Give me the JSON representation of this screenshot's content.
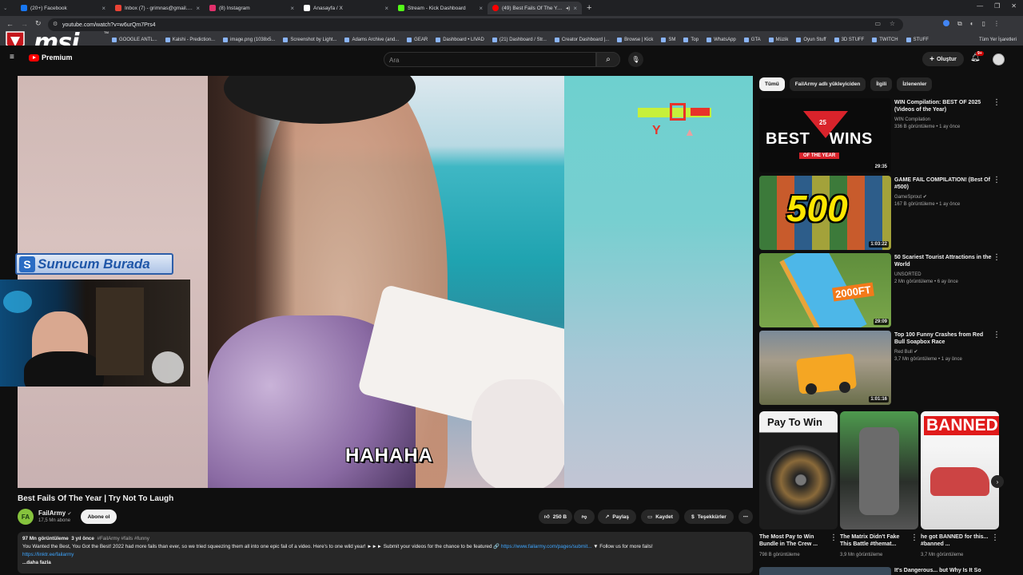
{
  "browser": {
    "tabs": [
      {
        "title": "(20+) Facebook",
        "color": "#1877f2"
      },
      {
        "title": "Inbox (7) - grimnas@gmail.com",
        "color": "#ea4335"
      },
      {
        "title": "(8) Instagram",
        "color": "#e1306c"
      },
      {
        "title": "Anasayfa / X",
        "color": "#ffffff"
      },
      {
        "title": "Stream - Kick Dashboard",
        "color": "#53fc18"
      },
      {
        "title": "(49) Best Fails Of The Year",
        "color": "#ff0000"
      }
    ],
    "url": "youtube.com/watch?v=w6urQm7Prs4",
    "bookmarks": [
      "GOOGLE ANTL...",
      "Kalshi - Prediction...",
      "image.png (1038x5...",
      "Screenshot by Light...",
      "Adams Archive (and...",
      "GEAR",
      "Dashboard • LIVAD",
      "(21) Dashboard / Str...",
      "Creator Dashboard |...",
      "Browse | Kick",
      "SM",
      "Top",
      "WhatsApp",
      "GTA",
      "Müzik",
      "Oyun Stuff",
      "3D STUFF",
      "TWITCH",
      "STUFF"
    ],
    "all_bookmarks": "Tüm Yer İşaretleri"
  },
  "overlay": {
    "logo": "msi",
    "tm": "TM",
    "streamer_tag": "Sunucum Burada"
  },
  "youtube": {
    "logo": "Premium",
    "search_placeholder": "Ara",
    "create_label": "Oluştur",
    "notif_count": "9+"
  },
  "player": {
    "caption": "HAHAHA"
  },
  "video": {
    "title": "Best Fails Of The Year | Try Not To Laugh",
    "channel": "FailArmy",
    "subs": "17,5 Mn abone",
    "subscribe": "Abone ol",
    "likes": "250 B",
    "share": "Paylaş",
    "save": "Kaydet",
    "thanks": "Teşekkürler",
    "views": "97 Mn görüntüleme",
    "age": "3 yıl önce",
    "tags": "#FailArmy #fails #funny",
    "desc": "You Wanted the Best, You Got the Best! 2022 had more fails than ever, so we tried squeezing them all into one epic fail of a video. Here's to one wild year! ►►► Submit your videos for the chance to be featured 🔗",
    "desc_link": "https://www.failarmy.com/pages/submit...",
    "desc_tail": "▼ Follow us for more fails!",
    "link2": "https://linktr.ee/failarmy",
    "more": "...daha fazla"
  },
  "sidebar": {
    "chips": [
      "Tümü",
      "FailArmy adlı yükleyiciden",
      "İlgili",
      "İzlenenler"
    ],
    "recs": [
      {
        "title": "WIN Compilation: BEST OF 2025 (Videos of the Year)",
        "channel": "WIN Compilation",
        "meta": "336 B görüntüleme • 1 ay önce",
        "duration": "29:35",
        "thumb_text": "BEST 25 WINS",
        "thumb_sub": "OF THE YEAR"
      },
      {
        "title": "GAME FAIL COMPILATION! (Best Of #500)",
        "channel": "GameSprout",
        "meta": "167 B görüntüleme • 1 ay önce",
        "duration": "1:03:22",
        "thumb_text": "500"
      },
      {
        "title": "50 Scariest Tourist Attractions in the World",
        "channel": "UNSORTED",
        "meta": "2 Mn görüntüleme • 6 ay önce",
        "duration": "29:09",
        "thumb_text": "2000FT"
      },
      {
        "title": "Top 100 Funny Crashes from Red Bull Soapbox Race",
        "channel": "Red Bull",
        "meta": "3,7 Mn görüntüleme • 1 ay önce",
        "duration": "1:01:16"
      }
    ],
    "shorts": [
      {
        "title": "The Most Pay to Win Bundle in The Crew ...",
        "views": "798 B görüntüleme",
        "thumb_text": "Pay To Win"
      },
      {
        "title": "The Matrix Didn't Fake This Battle #themat...",
        "views": "3,9 Mn görüntüleme"
      },
      {
        "title": "he got BANNED for this... #banned ...",
        "views": "3,7 Mn görüntüleme",
        "thumb_text": "BANNED"
      }
    ],
    "next_title": "It's Dangerous... but Why Is It So"
  },
  "colors": {
    "bg": "#0f0f0f",
    "yt_red": "#ff0000",
    "chip": "#272727"
  }
}
